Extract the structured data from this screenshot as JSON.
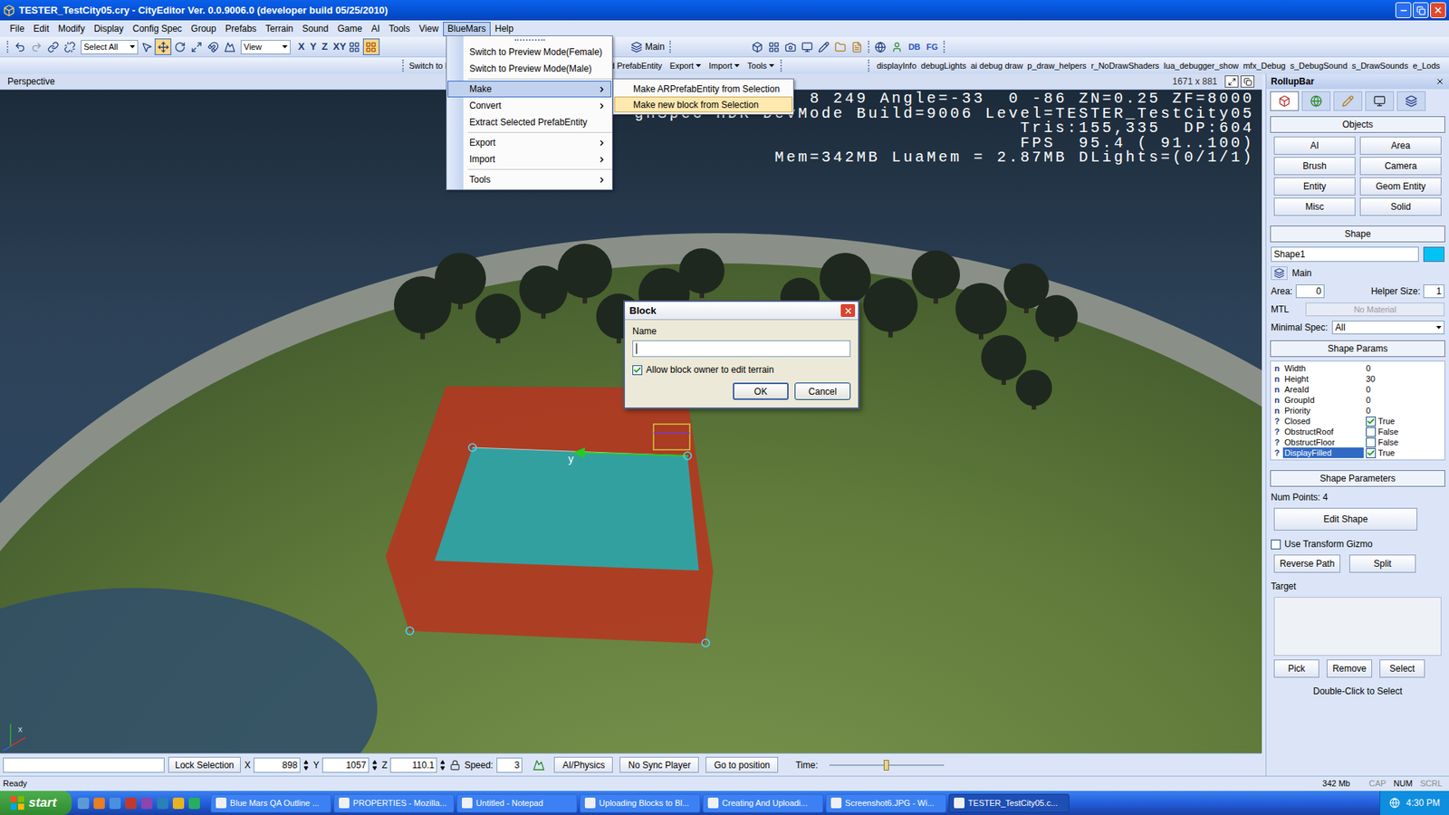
{
  "window": {
    "title": "TESTER_TestCity05.cry - CityEditor Ver. 0.0.9006.0 (developer build 05/25/2010)"
  },
  "menu_bar": [
    {
      "label": "File",
      "selected": false
    },
    {
      "label": "Edit",
      "selected": false
    },
    {
      "label": "Modify",
      "selected": false
    },
    {
      "label": "Display",
      "selected": false
    },
    {
      "label": "Config Spec",
      "selected": false
    },
    {
      "label": "Group",
      "selected": false
    },
    {
      "label": "Prefabs",
      "selected": false
    },
    {
      "label": "Terrain",
      "selected": false
    },
    {
      "label": "Sound",
      "selected": false
    },
    {
      "label": "Game",
      "selected": false
    },
    {
      "label": "AI",
      "selected": false
    },
    {
      "label": "Tools",
      "selected": false
    },
    {
      "label": "View",
      "selected": false
    },
    {
      "label": "BlueMars",
      "selected": true
    },
    {
      "label": "Help",
      "selected": false
    }
  ],
  "toolbar": {
    "select_combo": "Select All",
    "view_combo": "View",
    "axes": [
      "X",
      "Y",
      "Z",
      "XY"
    ],
    "layer": "Main",
    "tags": [
      "DB",
      "FG"
    ]
  },
  "toolbar2": {
    "left": "Switch to P",
    "menus": [
      {
        "label": "lected PrefabEntity",
        "dropdown": false
      },
      {
        "label": "Export",
        "dropdown": true
      },
      {
        "label": "Import",
        "dropdown": true
      },
      {
        "label": "Tools",
        "dropdown": true
      }
    ],
    "console_vars": [
      "displayInfo",
      "debugLights",
      "ai debug draw",
      "p_draw_helpers",
      "r_NoDrawShaders",
      "lua_debugger_show",
      "mfx_Debug",
      "s_DebugSound",
      "s_DrawSounds",
      "e_Lods"
    ]
  },
  "viewport": {
    "label": "Perspective",
    "resolution": "1671 x 881",
    "overlay": [
      "8 249 Angle=-33  0 -86 ZN=0.25 ZF=8000",
      "ghSpec HDR DevMode Build=9006 Level=TESTER_TestCity05",
      "Tris:155,335  DP:604",
      "FPS  95.4 ( 91..100)",
      "Mem=342MB LuaMem = 2.87MB DLights=(0/1/1)"
    ],
    "gizmo_label": "y",
    "axis_label": "x"
  },
  "bluemars_menu": [
    {
      "label": "Switch to Preview Mode(Female)",
      "kind": "item",
      "selected": false,
      "separator_before": false
    },
    {
      "label": "Switch to Preview Mode(Male)",
      "kind": "item",
      "selected": false,
      "separator_before": false
    },
    {
      "label": "Make",
      "kind": "submenu",
      "selected": true,
      "separator_before": true
    },
    {
      "label": "Convert",
      "kind": "submenu",
      "selected": false,
      "separator_before": false
    },
    {
      "label": "Extract Selected PrefabEntity",
      "kind": "item",
      "selected": false,
      "separator_before": false
    },
    {
      "label": "Export",
      "kind": "submenu",
      "selected": false,
      "separator_before": true
    },
    {
      "label": "Import",
      "kind": "submenu",
      "selected": false,
      "separator_before": false
    },
    {
      "label": "Tools",
      "kind": "submenu",
      "selected": false,
      "separator_before": true
    }
  ],
  "make_submenu": [
    {
      "label": "Make ARPrefabEntity from Selection",
      "selected": false
    },
    {
      "label": "Make new block from Selection",
      "selected": true
    }
  ],
  "dialog": {
    "title": "Block",
    "name_label": "Name",
    "name_value": "",
    "checkbox": {
      "label": "Allow block owner to edit terrain",
      "checked": true
    },
    "buttons": [
      {
        "label": "OK",
        "default": true
      },
      {
        "label": "Cancel",
        "default": false
      }
    ]
  },
  "rollup": {
    "title": "RollupBar",
    "tabs": [
      {
        "selected": true
      },
      {
        "selected": false
      },
      {
        "selected": false
      },
      {
        "selected": false
      },
      {
        "selected": false
      }
    ],
    "objects": {
      "title": "Objects",
      "buttons": [
        "AI",
        "Area",
        "Brush",
        "Camera",
        "Entity",
        "Geom Entity",
        "Misc",
        "Solid"
      ]
    },
    "shape": {
      "title": "Shape",
      "name": "Shape1",
      "layer": "Main",
      "area_label": "Area:",
      "area": "0",
      "helper_label": "Helper Size:",
      "helper": "1",
      "mtl_label": "MTL",
      "mtl": "No Material",
      "mtl_disabled": true,
      "spec_label": "Minimal Spec:",
      "spec": "All"
    },
    "params": {
      "title": "Shape Params",
      "rows": [
        {
          "marker": "n",
          "name": "Width",
          "kind": "number",
          "value": "0",
          "checked": false,
          "selected": false
        },
        {
          "marker": "n",
          "name": "Height",
          "kind": "number",
          "value": "30",
          "checked": false,
          "selected": false
        },
        {
          "marker": "n",
          "name": "AreaId",
          "kind": "number",
          "value": "0",
          "checked": false,
          "selected": false
        },
        {
          "marker": "n",
          "name": "GroupId",
          "kind": "number",
          "value": "0",
          "checked": false,
          "selected": false
        },
        {
          "marker": "n",
          "name": "Priority",
          "kind": "number",
          "value": "0",
          "checked": false,
          "selected": false
        },
        {
          "marker": "?",
          "name": "Closed",
          "kind": "bool",
          "value": "True",
          "checked": true,
          "selected": false
        },
        {
          "marker": "?",
          "name": "ObstructRoof",
          "kind": "bool",
          "value": "False",
          "checked": false,
          "selected": false
        },
        {
          "marker": "?",
          "name": "ObstructFloor",
          "kind": "bool",
          "value": "False",
          "checked": false,
          "selected": false
        },
        {
          "marker": "?",
          "name": "DisplayFilled",
          "kind": "bool",
          "value": "True",
          "checked": true,
          "selected": true
        }
      ]
    },
    "parameters": {
      "title": "Shape Parameters",
      "num_points": "Num Points: 4",
      "edit": "Edit Shape",
      "gizmo": {
        "label": "Use Transform Gizmo",
        "checked": false
      },
      "buttons": [
        "Reverse Path",
        "Split"
      ],
      "target_label": "Target",
      "target_buttons": [
        "Pick",
        "Remove",
        "Select"
      ],
      "hint": "Double-Click to Select"
    }
  },
  "bottom_bar": {
    "lock": "Lock Selection",
    "coords": [
      {
        "axis": "X",
        "value": "898"
      },
      {
        "axis": "Y",
        "value": "1057"
      },
      {
        "axis": "Z",
        "value": "110.1"
      }
    ],
    "speed_label": "Speed:",
    "speed": "3",
    "buttons": [
      "AI/Physics",
      "No Sync Player",
      "Go to position"
    ],
    "time_label": "Time:",
    "time_level": 0.5
  },
  "status_bar": {
    "text": "Ready",
    "memory": "342 Mb",
    "indicators": [
      {
        "label": "CAP",
        "on": false
      },
      {
        "label": "NUM",
        "on": true
      },
      {
        "label": "SCRL",
        "on": false
      }
    ]
  },
  "taskbar": {
    "start": "start",
    "tasks": [
      {
        "label": "Blue Mars QA Outline ...",
        "selected": false
      },
      {
        "label": "PROPERTIES - Mozilla...",
        "selected": false
      },
      {
        "label": "Untitled - Notepad",
        "selected": false
      },
      {
        "label": "Uploading Blocks to Bl...",
        "selected": false
      },
      {
        "label": "Creating And Uploadi...",
        "selected": false
      },
      {
        "label": "Screenshot6.JPG - Wi...",
        "selected": false
      },
      {
        "label": "TESTER_TestCity05.c...",
        "selected": true
      }
    ],
    "clock": "4:30 PM"
  }
}
